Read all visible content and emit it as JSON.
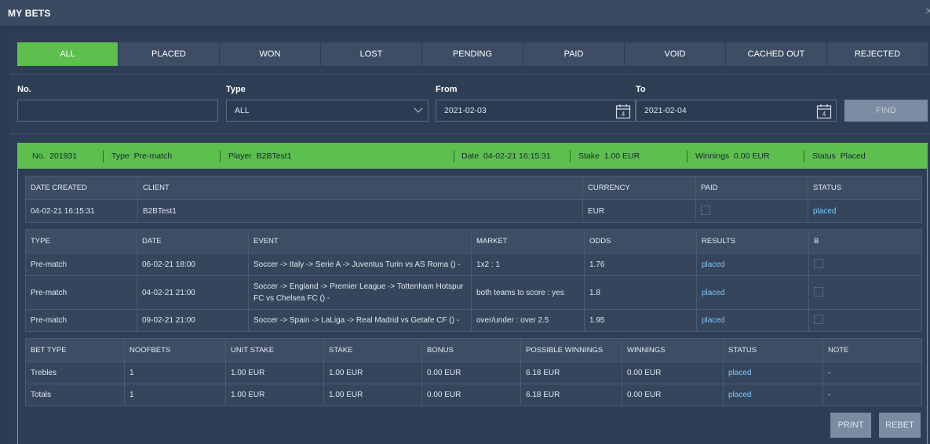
{
  "window": {
    "title": "MY BETS",
    "close": "×"
  },
  "tabs": [
    {
      "label": "ALL",
      "active": true
    },
    {
      "label": "PLACED"
    },
    {
      "label": "WON"
    },
    {
      "label": "LOST"
    },
    {
      "label": "PENDING"
    },
    {
      "label": "PAID"
    },
    {
      "label": "VOID"
    },
    {
      "label": "CACHED OUT"
    },
    {
      "label": "REJECTED"
    }
  ],
  "filters": {
    "no": {
      "label": "No.",
      "value": ""
    },
    "type": {
      "label": "Type",
      "value": "ALL"
    },
    "from": {
      "label": "From",
      "value": "2021-02-03",
      "cal_day": "4"
    },
    "to": {
      "label": "To",
      "value": "2021-02-04",
      "cal_day": "4"
    },
    "find_label": "FIND"
  },
  "bet_header": {
    "no_label": "No.",
    "no": "201931",
    "type_label": "Type",
    "type": "Pre-match",
    "player_label": "Player",
    "player": "B2BTest1",
    "date_label": "Date",
    "date": "04-02-21 16:15:31",
    "stake_label": "Stake",
    "stake": "1.00 EUR",
    "winnings_label": "Winnings",
    "winnings": "0.00 EUR",
    "status_label": "Status",
    "status": "Placed"
  },
  "client_table": {
    "headers": [
      "DATE CREATED",
      "CLIENT",
      "CURRENCY",
      "PAID",
      "STATUS"
    ],
    "row": {
      "date_created": "04-02-21 16:15:31",
      "client": "B2BTest1",
      "currency": "EUR",
      "status": "placed"
    }
  },
  "events_table": {
    "headers": [
      "TYPE",
      "DATE",
      "EVENT",
      "MARKET",
      "ODDS",
      "RESULTS",
      "B"
    ],
    "rows": [
      {
        "type": "Pre-match",
        "date": "06-02-21 18:00",
        "event": "Soccer -> Italy -> Serie A -> Juventus Turin vs AS Roma () -",
        "market": "1x2 : 1",
        "odds": "1.76",
        "result": "placed"
      },
      {
        "type": "Pre-match",
        "date": "04-02-21 21:00",
        "event": "Soccer -> England -> Premier League -> Tottenham Hotspur FC vs Chelsea FC () -",
        "market": "both teams to score : yes",
        "odds": "1.8",
        "result": "placed"
      },
      {
        "type": "Pre-match",
        "date": "09-02-21 21:00",
        "event": "Soccer -> Spain -> LaLiga -> Real Madrid vs Getafe CF () -",
        "market": "over/under : over 2.5",
        "odds": "1.95",
        "result": "placed"
      }
    ]
  },
  "summary_table": {
    "headers": [
      "BET TYPE",
      "NOOFBETS",
      "UNIT STAKE",
      "STAKE",
      "BONUS",
      "POSSIBLE WINNINGS",
      "WINNINGS",
      "STATUS",
      "NOTE"
    ],
    "rows": [
      {
        "bet_type": "Trebles",
        "noofbets": "1",
        "unit_stake": "1.00 EUR",
        "stake": "1.00 EUR",
        "bonus": "0.00 EUR",
        "possible_winnings": "6.18 EUR",
        "winnings": "0.00 EUR",
        "status": "placed",
        "note": "-"
      },
      {
        "bet_type": "Totals",
        "noofbets": "1",
        "unit_stake": "1.00 EUR",
        "stake": "1.00 EUR",
        "bonus": "0.00 EUR",
        "possible_winnings": "6.18 EUR",
        "winnings": "0.00 EUR",
        "status": "placed",
        "note": "-"
      }
    ]
  },
  "actions": {
    "print": "PRINT",
    "rebet": "REBET"
  }
}
